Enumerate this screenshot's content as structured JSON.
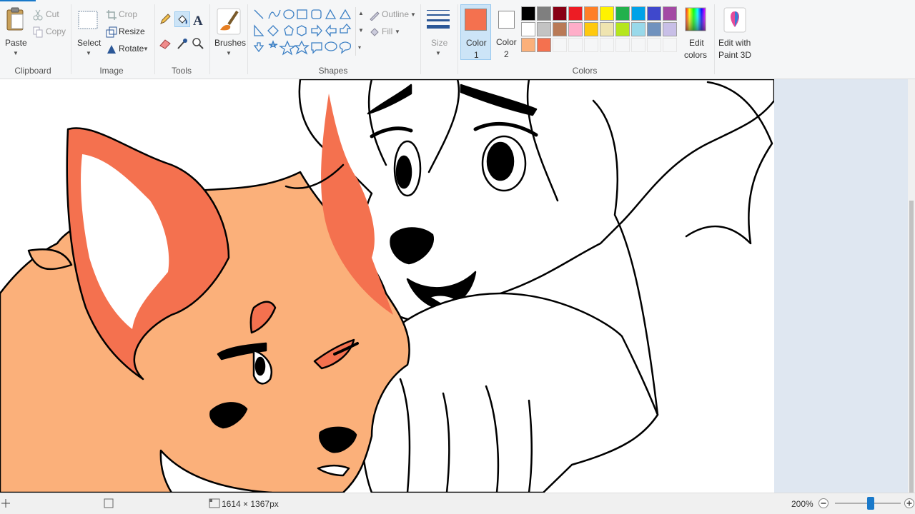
{
  "ribbon": {
    "clipboard": {
      "paste": "Paste",
      "cut": "Cut",
      "copy": "Copy",
      "group": "Clipboard"
    },
    "image": {
      "select": "Select",
      "crop": "Crop",
      "resize": "Resize",
      "rotate": "Rotate",
      "group": "Image"
    },
    "tools": {
      "group": "Tools"
    },
    "brushes": {
      "label": "Brushes"
    },
    "shapes": {
      "outline": "Outline",
      "fill": "Fill",
      "group": "Shapes"
    },
    "size": {
      "label": "Size"
    },
    "colors": {
      "color1_label": "Color",
      "color1_num": "1",
      "color2_label": "Color",
      "color2_num": "2",
      "edit_colors_1": "Edit",
      "edit_colors_2": "colors",
      "paint3d_1": "Edit with",
      "paint3d_2": "Paint 3D",
      "group": "Colors",
      "color1_value": "#f4714f",
      "color2_value": "#ffffff",
      "palette_row1": [
        "#000000",
        "#7f7f7f",
        "#880015",
        "#ed1c24",
        "#ff7f27",
        "#fff200",
        "#22b14c",
        "#00a2e8",
        "#3f48cc",
        "#a349a4"
      ],
      "palette_row2": [
        "#ffffff",
        "#c3c3c3",
        "#b97a57",
        "#ffaec9",
        "#ffc90e",
        "#efe4b0",
        "#b5e61d",
        "#99d9ea",
        "#7092be",
        "#c8bfe7"
      ],
      "palette_row3": [
        "#fbb07a",
        "#f4714f"
      ]
    }
  },
  "status": {
    "image_size": "1614 × 1367px",
    "zoom": "200%"
  }
}
